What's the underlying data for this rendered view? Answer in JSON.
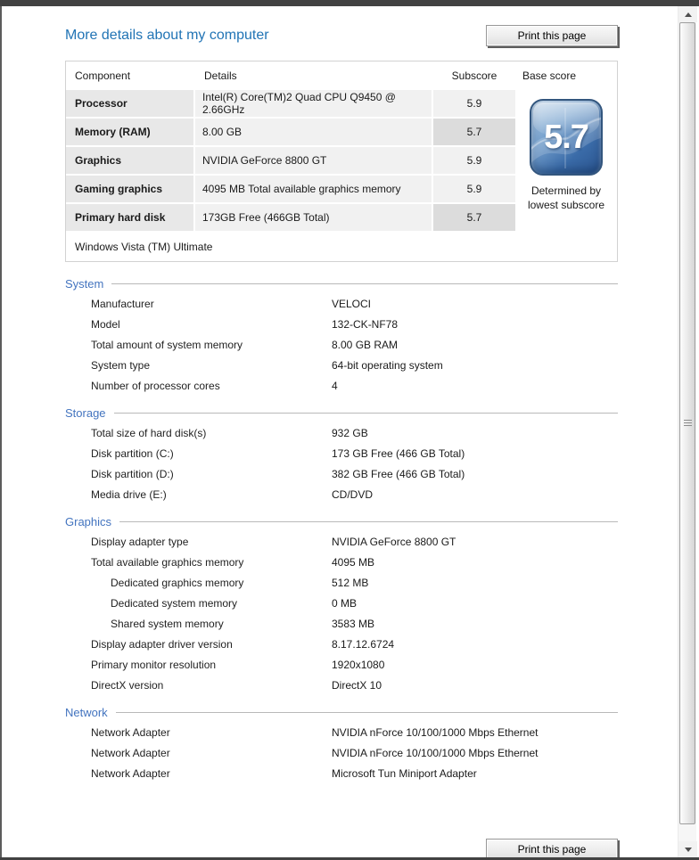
{
  "window": {
    "title": "More details about my computer",
    "print_button_label": "Print this page"
  },
  "score_table": {
    "headers": {
      "component": "Component",
      "details": "Details",
      "subscore": "Subscore",
      "base_score": "Base score"
    },
    "rows": [
      {
        "component": "Processor",
        "details": "Intel(R) Core(TM)2 Quad CPU Q9450 @ 2.66GHz",
        "subscore": "5.9",
        "is_lowest": false
      },
      {
        "component": "Memory (RAM)",
        "details": "8.00 GB",
        "subscore": "5.7",
        "is_lowest": true
      },
      {
        "component": "Graphics",
        "details": "NVIDIA GeForce 8800 GT",
        "subscore": "5.9",
        "is_lowest": false
      },
      {
        "component": "Gaming graphics",
        "details": "4095 MB Total available graphics memory",
        "subscore": "5.9",
        "is_lowest": false
      },
      {
        "component": "Primary hard disk",
        "details": "173GB Free (466GB Total)",
        "subscore": "5.7",
        "is_lowest": true
      }
    ],
    "os_name": "Windows Vista (TM) Ultimate",
    "base_score": {
      "value": "5.7",
      "caption_line1": "Determined by",
      "caption_line2": "lowest subscore"
    }
  },
  "sections": [
    {
      "title": "System",
      "rows": [
        {
          "label": "Manufacturer",
          "value": "VELOCI"
        },
        {
          "label": "Model",
          "value": "132-CK-NF78"
        },
        {
          "label": "Total amount of system memory",
          "value": "8.00 GB RAM"
        },
        {
          "label": "System type",
          "value": "64-bit operating system"
        },
        {
          "label": "Number of processor cores",
          "value": "4"
        }
      ]
    },
    {
      "title": "Storage",
      "rows": [
        {
          "label": "Total size of hard disk(s)",
          "value": "932 GB"
        },
        {
          "label": "Disk partition (C:)",
          "value": "173 GB Free (466 GB Total)"
        },
        {
          "label": "Disk partition (D:)",
          "value": "382 GB Free (466 GB Total)"
        },
        {
          "label": "Media drive (E:)",
          "value": "CD/DVD"
        }
      ]
    },
    {
      "title": "Graphics",
      "rows": [
        {
          "label": "Display adapter type",
          "value": "NVIDIA GeForce 8800 GT"
        },
        {
          "label": "Total available graphics memory",
          "value": "4095 MB"
        },
        {
          "label": "Dedicated graphics memory",
          "value": "512 MB",
          "indent": true
        },
        {
          "label": "Dedicated system memory",
          "value": "0 MB",
          "indent": true
        },
        {
          "label": "Shared system memory",
          "value": "3583 MB",
          "indent": true
        },
        {
          "label": "Display adapter driver version",
          "value": "8.17.12.6724"
        },
        {
          "label": "Primary monitor resolution",
          "value": "1920x1080"
        },
        {
          "label": "DirectX version",
          "value": "DirectX 10"
        }
      ]
    },
    {
      "title": "Network",
      "rows": [
        {
          "label": "Network Adapter",
          "value": "NVIDIA nForce 10/100/1000 Mbps Ethernet"
        },
        {
          "label": "Network Adapter",
          "value": "NVIDIA nForce 10/100/1000 Mbps Ethernet"
        },
        {
          "label": "Network Adapter",
          "value": "Microsoft Tun Miniport Adapter"
        }
      ]
    }
  ],
  "icons": {
    "scroll_up": "triangle-up",
    "scroll_down": "triangle-down",
    "badge_flag": "windows-flag"
  },
  "colors": {
    "title_blue": "#2174b5",
    "section_blue": "#4374bf",
    "badge_blue_light": "#b2cce4",
    "badge_blue_dark": "#2b5590",
    "row_gray": "#f1f1f1",
    "component_gray": "#e8e8e8",
    "lowest_subscore_gray": "#dcdcdc",
    "frame_dark": "#424242"
  }
}
